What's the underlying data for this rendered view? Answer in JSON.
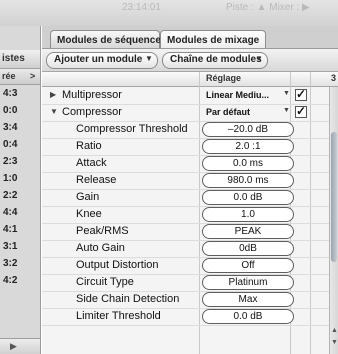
{
  "topbar": {
    "ghost_time": "23:14:01",
    "ghost_right": "Piste : ▲   Mixer : ▶"
  },
  "left": {
    "header": "istes",
    "subheader": "rée",
    "subheader_arrow": ">",
    "rows": [
      "4:3",
      "0:0",
      "3:4",
      "0:4",
      "2:3",
      "1:0",
      "2:2",
      "4:4",
      "4:1",
      "3:1",
      "3:2",
      "4:2"
    ],
    "foot_arrow": "▶"
  },
  "tabs": [
    {
      "label": "Modules de séquence",
      "active": false
    },
    {
      "label": "Modules de mixage",
      "active": true
    }
  ],
  "toolbar": {
    "add_module_label": "Ajouter un module",
    "add_module_chevron": "▼",
    "chain_label": "Chaîne de modules",
    "chain_chevron": "▼"
  },
  "table": {
    "col_setting": "Réglage",
    "col_right": "3",
    "modules": [
      {
        "name": "Multipressor",
        "preset": "Linear Mediu...",
        "arrow": "▼",
        "expanded": false,
        "enabled": true,
        "check": "✓",
        "tri": "▶"
      },
      {
        "name": "Compressor",
        "preset": "Par défaut",
        "arrow": "▼",
        "expanded": true,
        "enabled": true,
        "check": "✓",
        "tri": "▼"
      }
    ],
    "params": [
      {
        "name": "Compressor Threshold",
        "value": "–20.0 dB"
      },
      {
        "name": "Ratio",
        "value": "2.0 :1"
      },
      {
        "name": "Attack",
        "value": "0.0 ms"
      },
      {
        "name": "Release",
        "value": "980.0 ms"
      },
      {
        "name": "Gain",
        "value": "0.0 dB"
      },
      {
        "name": "Knee",
        "value": "1.0"
      },
      {
        "name": "Peak/RMS",
        "value": "PEAK"
      },
      {
        "name": "Auto Gain",
        "value": "0dB"
      },
      {
        "name": "Output Distortion",
        "value": "Off"
      },
      {
        "name": "Circuit Type",
        "value": "Platinum"
      },
      {
        "name": "Side Chain Detection",
        "value": "Max"
      },
      {
        "name": "Limiter Threshold",
        "value": "0.0 dB"
      }
    ]
  },
  "scroll": {
    "up": "▲",
    "down": "▼"
  }
}
